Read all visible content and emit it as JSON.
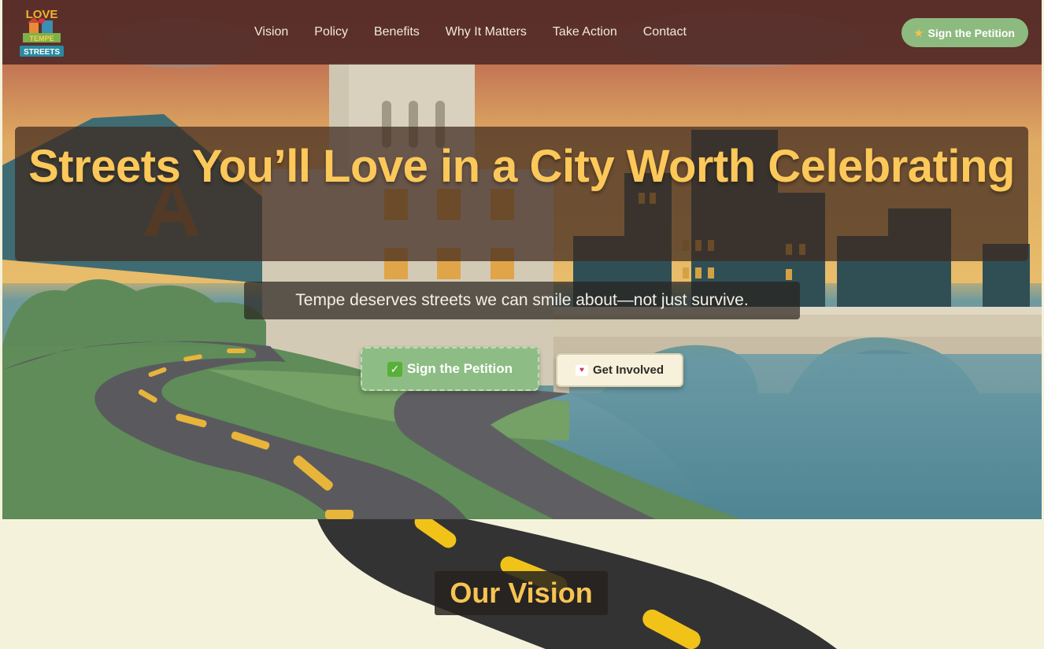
{
  "brand": {
    "logo_text_top": "LOVE",
    "logo_text_mid": "TEMPE",
    "logo_text_bottom": "STREETS"
  },
  "nav": {
    "links": [
      "Vision",
      "Policy",
      "Benefits",
      "Why It Matters",
      "Take Action",
      "Contact"
    ],
    "cta_label": "Sign the Petition",
    "cta_icon": "star-icon"
  },
  "hero": {
    "title": "Streets You’ll Love in a City Worth Celebrating",
    "subtitle": "Tempe deserves streets we can smile about—not just survive.",
    "primary_button": "Sign the Petition",
    "primary_icon": "checkmark-icon",
    "secondary_button": "Get Involved",
    "secondary_icon": "heart-icon"
  },
  "vision": {
    "title": "Our Vision"
  },
  "colors": {
    "nav_bg": "#542c28",
    "accent_yellow": "#fcc85a",
    "cta_green": "#8dba7f",
    "cream": "#f5f2dc"
  }
}
